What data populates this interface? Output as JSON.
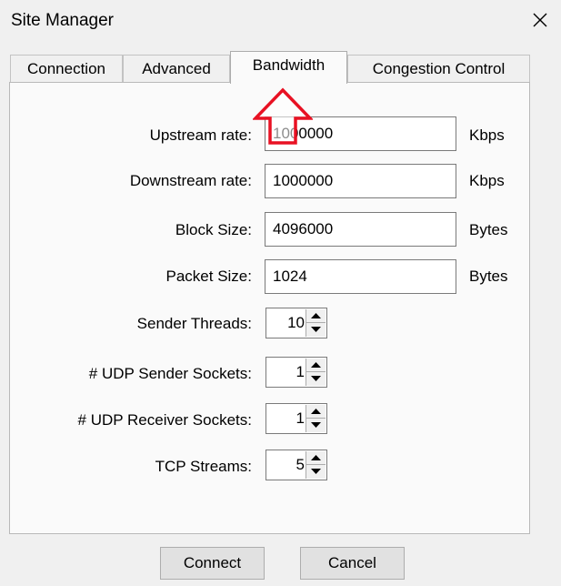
{
  "window": {
    "title": "Site Manager"
  },
  "icons": {
    "close": "close-icon",
    "spin_up": "arrow-up-icon",
    "spin_down": "arrow-down-icon",
    "annotation": "red-up-arrow-icon"
  },
  "colors": {
    "annotation_arrow": "#e81123",
    "panel_bg": "#fafafa",
    "window_bg": "#f0f0f0"
  },
  "tabs": [
    {
      "label": "Connection",
      "active": false
    },
    {
      "label": "Advanced",
      "active": false
    },
    {
      "label": "Bandwidth",
      "active": true
    },
    {
      "label": "Congestion Control",
      "active": false
    }
  ],
  "bandwidth": {
    "upstream": {
      "label": "Upstream rate:",
      "value": "1000000",
      "unit": "Kbps"
    },
    "downstream": {
      "label": "Downstream rate:",
      "value": "1000000",
      "unit": "Kbps"
    },
    "block_size": {
      "label": "Block Size:",
      "value": "4096000",
      "unit": "Bytes"
    },
    "packet_size": {
      "label": "Packet Size:",
      "value": "1024",
      "unit": "Bytes"
    },
    "sender_threads": {
      "label": "Sender Threads:",
      "value": "10"
    },
    "udp_sender_sockets": {
      "label": "# UDP Sender Sockets:",
      "value": "1"
    },
    "udp_receiver_sockets": {
      "label": "# UDP Receiver Sockets:",
      "value": "1"
    },
    "tcp_streams": {
      "label": "TCP Streams:",
      "value": "5"
    }
  },
  "buttons": {
    "connect": "Connect",
    "cancel": "Cancel"
  }
}
